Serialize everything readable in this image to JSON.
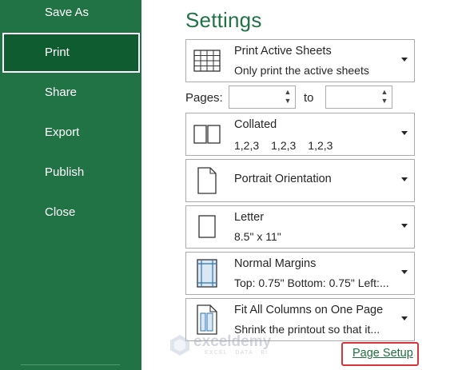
{
  "sidebar": {
    "items": [
      {
        "label": "Save As"
      },
      {
        "label": "Print"
      },
      {
        "label": "Share"
      },
      {
        "label": "Export"
      },
      {
        "label": "Publish"
      },
      {
        "label": "Close"
      }
    ],
    "active": "Print",
    "color": "#217346"
  },
  "settings": {
    "title": "Settings",
    "print_what": {
      "title": "Print Active Sheets",
      "subtitle": "Only print the active sheets",
      "icon": "sheet-grid-icon"
    },
    "pages": {
      "label": "Pages:",
      "from_value": "",
      "to_label": "to",
      "to_value": ""
    },
    "collation": {
      "title": "Collated",
      "sets": [
        "1,2,3",
        "1,2,3",
        "1,2,3"
      ],
      "icon": "collated-icon"
    },
    "orientation": {
      "title": "Portrait Orientation",
      "icon": "portrait-page-icon"
    },
    "paper": {
      "title": "Letter",
      "subtitle": "8.5\" x 11\"",
      "icon": "letter-page-icon"
    },
    "margins": {
      "title": "Normal Margins",
      "subtitle": "Top: 0.75\" Bottom: 0.75\" Left:...",
      "icon": "margins-icon"
    },
    "scaling": {
      "title": "Fit All Columns on One Page",
      "subtitle": "Shrink the printout so that it...",
      "icon": "fit-columns-icon"
    },
    "page_setup_link": "Page Setup"
  },
  "watermark": {
    "name": "exceldemy",
    "tagline": "EXCEL · DATA · BI"
  }
}
